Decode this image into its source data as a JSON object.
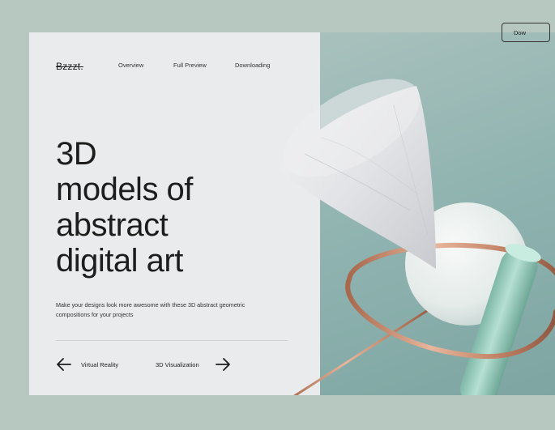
{
  "header": {
    "logo": "Bzzzt.",
    "nav": [
      "Overview",
      "Full Preview",
      "Downloading"
    ],
    "download_label": "Dow"
  },
  "hero": {
    "title_lines": [
      "3D",
      "models of",
      "abstract",
      "digital art"
    ],
    "description": "Make your designs look more awesome with these 3D abstract geometric compositions for your projects"
  },
  "pager": {
    "prev_label": "Virtual Reality",
    "next_label": "3D Visualization"
  },
  "colors": {
    "background": "#b7c8c0",
    "panel": "#e9ebec",
    "accent_teal": "#8fb3b0",
    "copper": "#c9927a",
    "mint": "#a6d3c5"
  }
}
